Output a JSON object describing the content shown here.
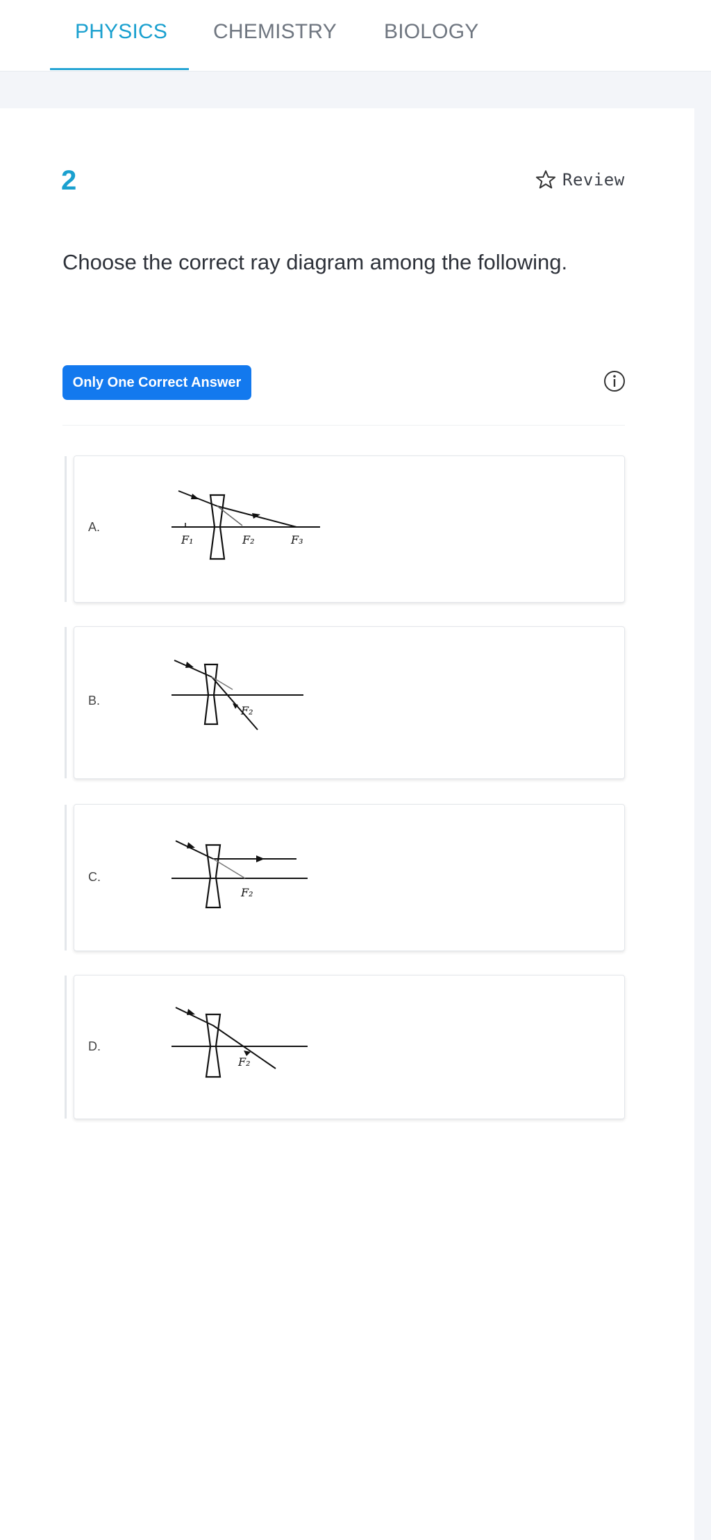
{
  "tabs": [
    {
      "label": "PHYSICS",
      "active": true
    },
    {
      "label": "CHEMISTRY",
      "active": false
    },
    {
      "label": "BIOLOGY",
      "active": false
    }
  ],
  "question": {
    "number": "2",
    "text": "Choose the correct ray diagram among the following.",
    "review_label": "Review",
    "answer_type": "Only One Correct Answer"
  },
  "options": [
    {
      "letter": "A.",
      "labels": [
        "F1",
        "F2",
        "F3"
      ]
    },
    {
      "letter": "B.",
      "labels": [
        "F2"
      ]
    },
    {
      "letter": "C.",
      "labels": [
        "F2"
      ]
    },
    {
      "letter": "D.",
      "labels": [
        "F2"
      ]
    }
  ],
  "colors": {
    "accent": "#1aa0cf",
    "badge": "#1379ee",
    "background": "#f3f5f9"
  },
  "icons": [
    "star-icon",
    "info-icon"
  ]
}
